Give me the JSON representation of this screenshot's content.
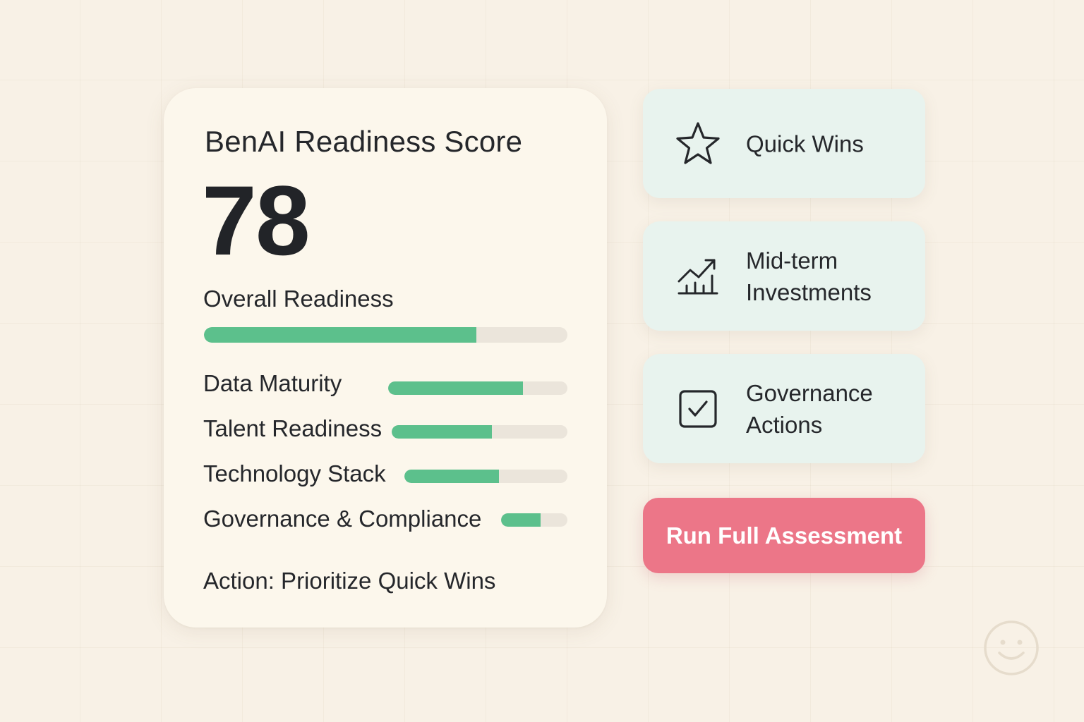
{
  "score_card": {
    "title": "BenAI Readiness Score",
    "score": "78",
    "overall_label": "Overall Readiness",
    "overall_progress": 0.75,
    "metrics": [
      {
        "label": "Data Maturity",
        "progress": 0.75
      },
      {
        "label": "Talent Readiness",
        "progress": 0.57
      },
      {
        "label": "Technology Stack",
        "progress": 0.58
      },
      {
        "label": "Governance & Compliance",
        "progress": 0.6
      }
    ],
    "action_text": "Action: Prioritize Quick Wins"
  },
  "tiles": [
    {
      "label": "Quick Wins",
      "icon": "star-icon"
    },
    {
      "label": "Mid-term Investments",
      "icon": "trending-chart-icon"
    },
    {
      "label": "Governance Actions",
      "icon": "checkbox-icon"
    }
  ],
  "cta": {
    "label": "Run Full Assessment"
  },
  "colors": {
    "background": "#f8f1e6",
    "card": "#fcf7ec",
    "progress_fill": "#5cc08c",
    "progress_track": "#ebe5db",
    "tile": "#e8f3ee",
    "cta": "#ec7688",
    "text": "#25272b"
  }
}
